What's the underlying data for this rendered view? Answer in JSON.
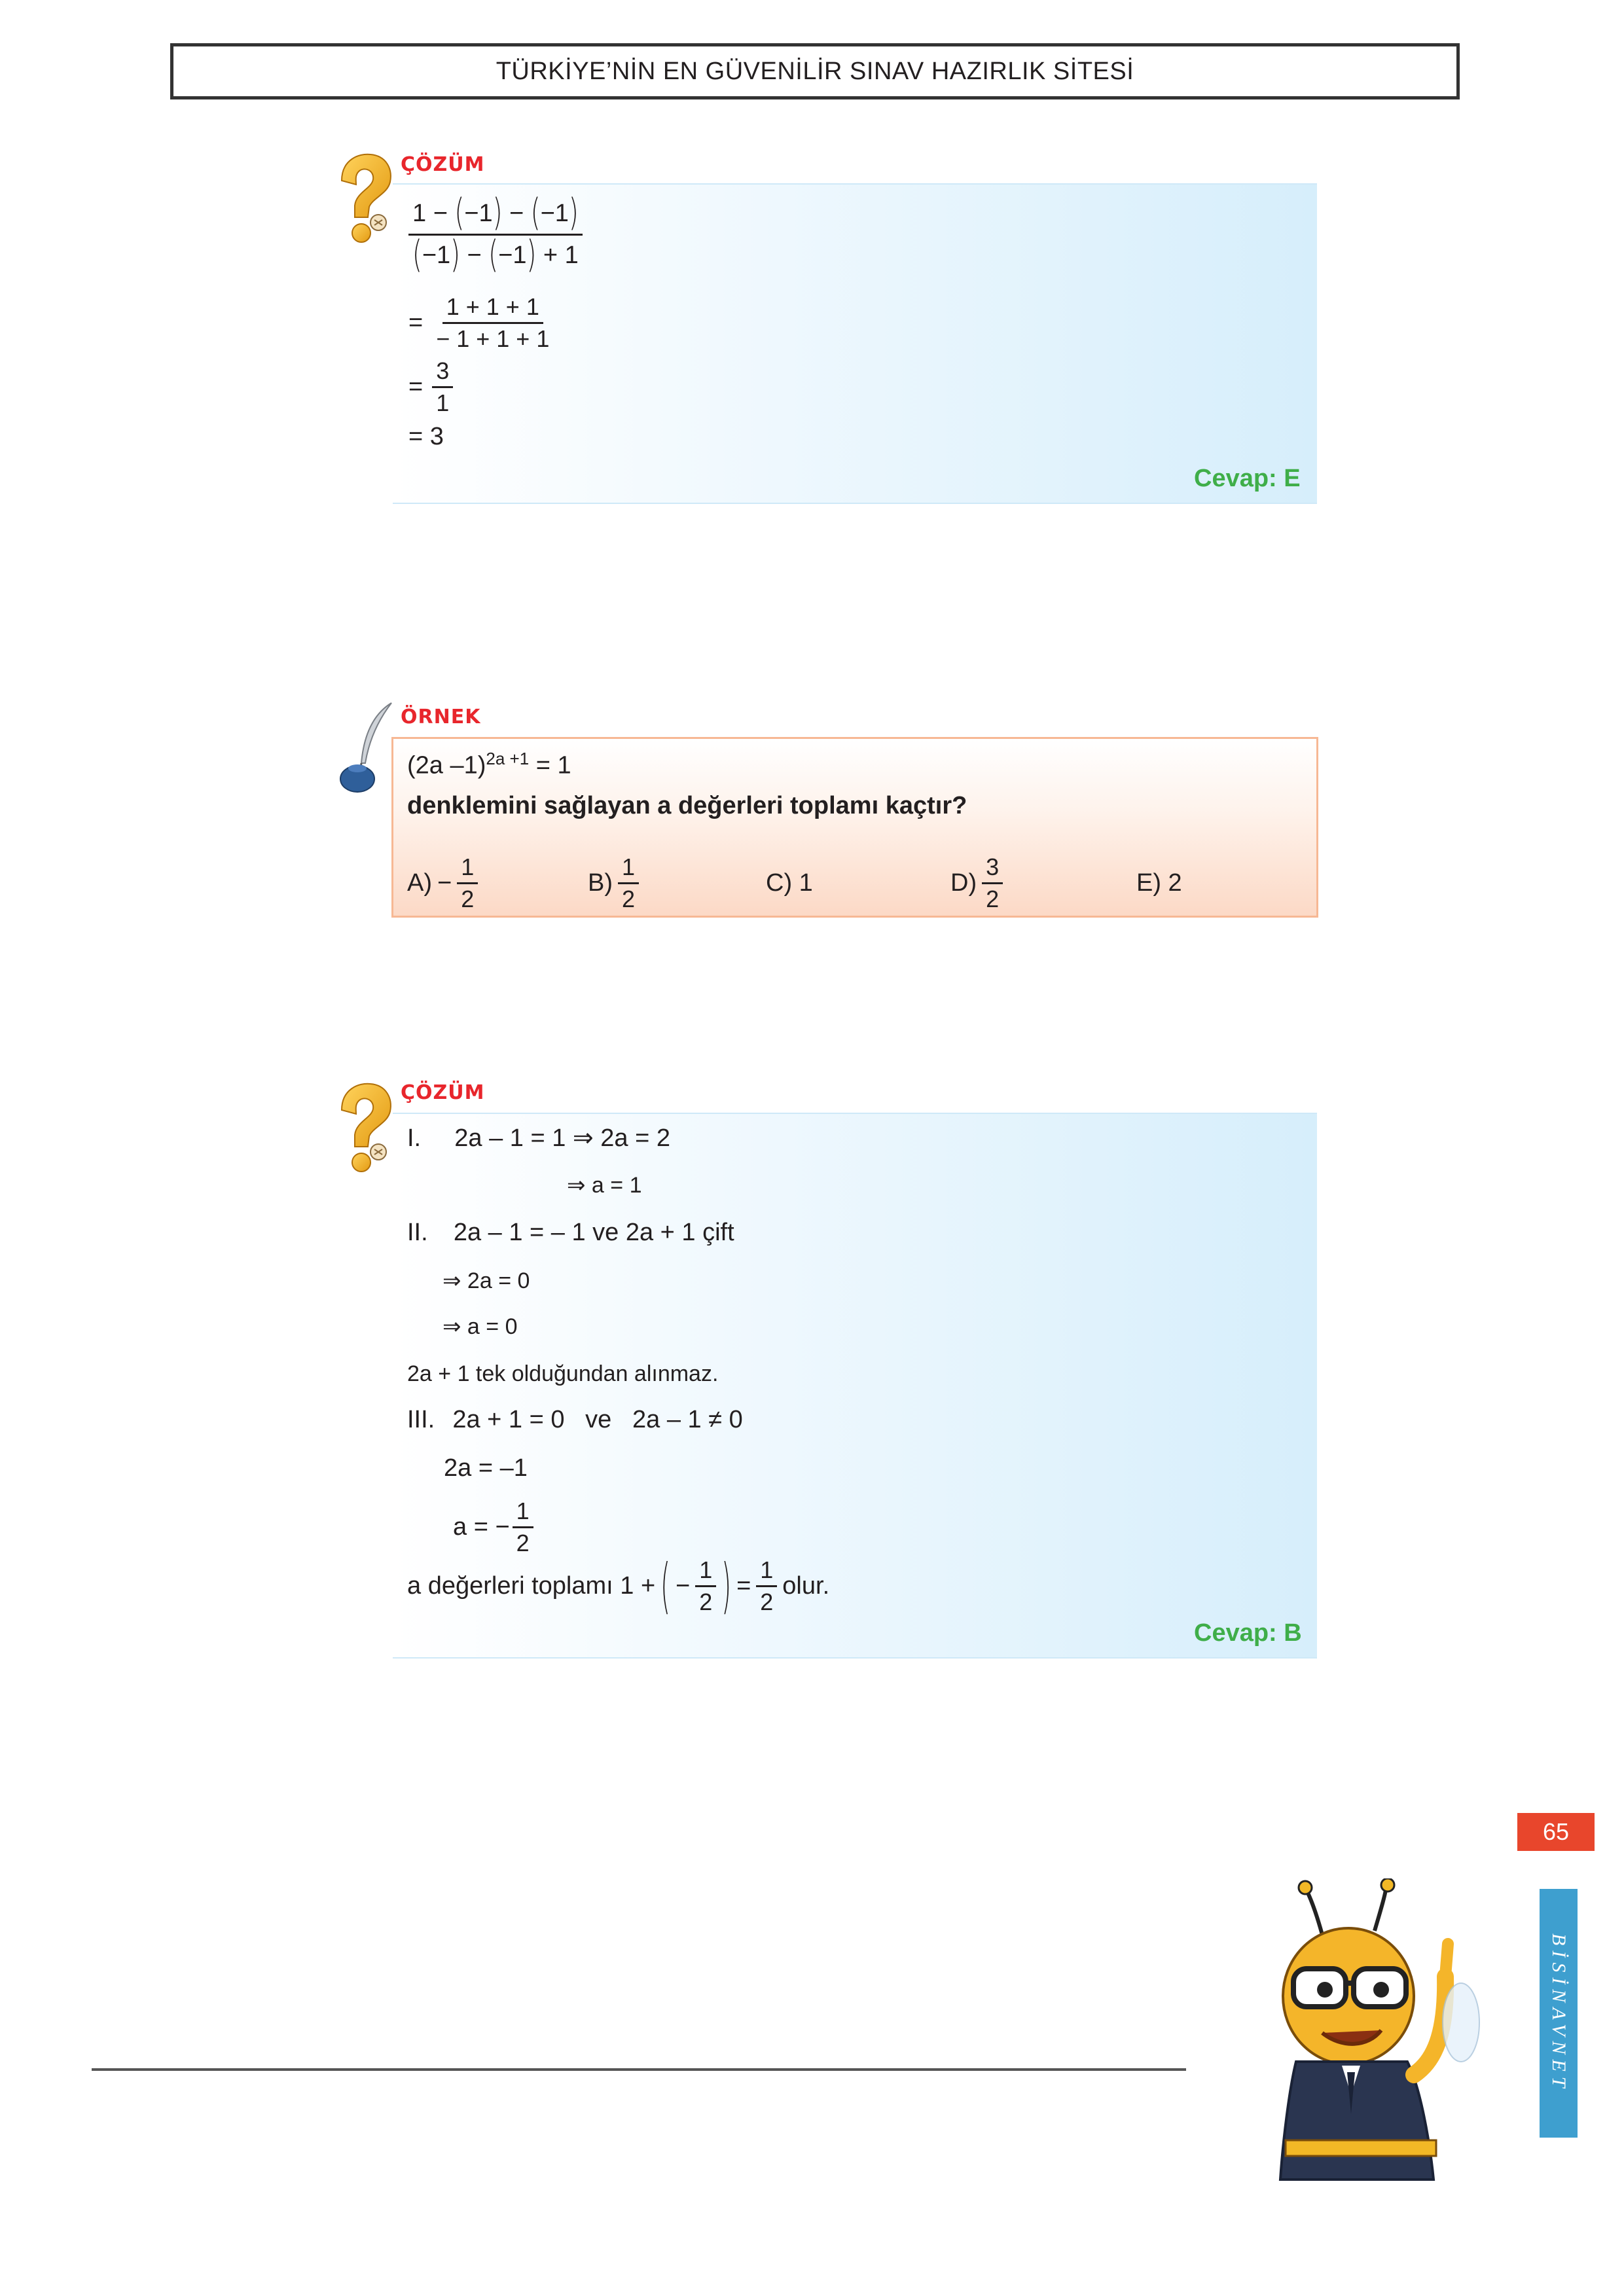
{
  "header": {
    "title": "TÜRKİYE’NİN EN GÜVENİLİR SINAV HAZIRLIK SİTESİ"
  },
  "solution1": {
    "label": "ÇÖZÜM",
    "num_a": "1",
    "num_b": "−1",
    "num_c": "−1",
    "den_a": "−1",
    "den_b": "−1",
    "den_c": "+ 1",
    "step2_num": "1 + 1 + 1",
    "step2_den": "− 1 + 1 + 1",
    "step3_num": "3",
    "step3_den": "1",
    "step4": "= 3",
    "answer": "Cevap: E"
  },
  "example": {
    "label": "ÖRNEK",
    "equation_base": "(2a –1)",
    "equation_exp": "2a +1",
    "equation_rhs": " = 1",
    "question": "denklemini sağlayan a değerleri toplamı kaçtır?",
    "choices": {
      "a_label": "A)",
      "a_sign": "−",
      "a_num": "1",
      "a_den": "2",
      "b_label": "B)",
      "b_num": "1",
      "b_den": "2",
      "c_text": "C) 1",
      "d_label": "D)",
      "d_num": "3",
      "d_den": "2",
      "e_text": "E) 2"
    }
  },
  "solution2": {
    "label": "ÇÖZÜM",
    "l1_roman": "I.",
    "l1_text": "2a – 1 = 1 ⇒ 2a = 2",
    "l2": "⇒ a = 1",
    "l3_roman": "II.",
    "l3_text": "2a – 1 = – 1 ve 2a + 1 çift",
    "l4": "⇒ 2a = 0",
    "l5": "⇒ a = 0",
    "l6": "2a + 1 tek olduğundan alınmaz.",
    "l7_roman": "III.",
    "l7_text": "2a + 1 = 0   ve   2a – 1 ≠ 0",
    "l8": "2a = –1",
    "l9_prefix": "a = −",
    "l9_num": "1",
    "l9_den": "2",
    "l10_prefix": "a değerleri toplamı 1 +",
    "l10_inner_sign": "−",
    "l10_inner_num": "1",
    "l10_inner_den": "2",
    "l10_eq": "=",
    "l10_res_num": "1",
    "l10_res_den": "2",
    "l10_suffix": "olur.",
    "answer": "Cevap: B"
  },
  "page_number": "65",
  "sidebar_brand": "BİSİNAVNET"
}
